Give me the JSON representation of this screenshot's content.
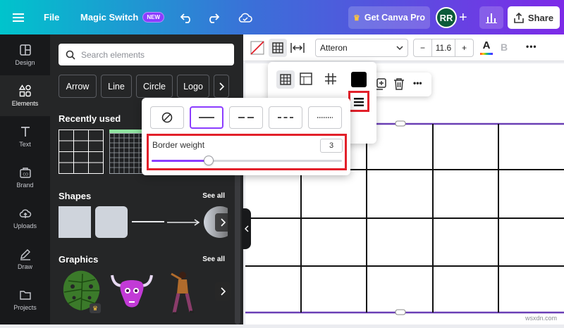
{
  "topbar": {
    "menu_icon": "hamburger-icon",
    "file_label": "File",
    "magic_switch_label": "Magic Switch",
    "new_badge": "NEW",
    "canva_pro_label": "Get Canva Pro",
    "avatar_initials": "RR",
    "share_label": "Share"
  },
  "rail": {
    "items": [
      {
        "label": "Design",
        "icon": "layout-icon"
      },
      {
        "label": "Elements",
        "icon": "shapes-icon"
      },
      {
        "label": "Text",
        "icon": "text-icon"
      },
      {
        "label": "Brand",
        "icon": "brand-kit-icon"
      },
      {
        "label": "Uploads",
        "icon": "cloud-upload-icon"
      },
      {
        "label": "Draw",
        "icon": "pen-icon"
      },
      {
        "label": "Projects",
        "icon": "folder-icon"
      }
    ],
    "active_index": 1
  },
  "panel": {
    "search_placeholder": "Search elements",
    "chips": [
      "Arrow",
      "Line",
      "Circle",
      "Logo"
    ],
    "recently_used_title": "Recently used",
    "shapes_title": "Shapes",
    "shapes_see_all": "See all",
    "graphics_title": "Graphics",
    "graphics_see_all": "See all"
  },
  "toolbar": {
    "font_name": "Atteron",
    "font_size": "11.6",
    "minus": "−",
    "plus": "+",
    "text_color_letter": "A",
    "bold_letter": "B",
    "more": "•••"
  },
  "border_popup": {
    "weight_label": "Border weight",
    "weight_value": "3",
    "weight_fraction": 0.3
  },
  "colors": {
    "accent": "#8b3dff",
    "highlight": "#e2202a",
    "text_color_bar": "#6a1bff"
  },
  "watermark": "wsxdn.com"
}
